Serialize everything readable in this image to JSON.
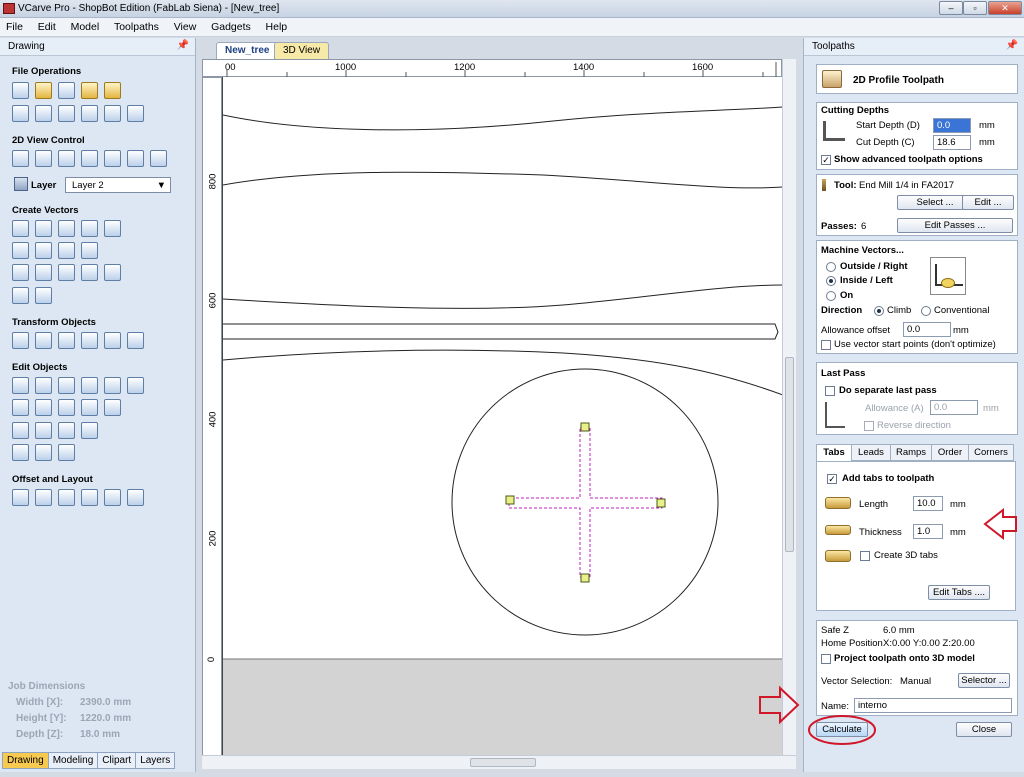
{
  "window": {
    "title": "VCarve Pro - ShopBot Edition (FabLab Siena) - [New_tree]",
    "min": "–",
    "max": "▫",
    "close": "✕"
  },
  "menu": [
    "File",
    "Edit",
    "Model",
    "Toolpaths",
    "View",
    "Gadgets",
    "Help"
  ],
  "left_panel": {
    "title": "Drawing",
    "sections": {
      "file_operations": "File Operations",
      "view_control": "2D View Control",
      "layer_label": "Layer",
      "layer_value": "Layer 2",
      "create_vectors": "Create Vectors",
      "transform_objects": "Transform Objects",
      "edit_objects": "Edit Objects",
      "offset_layout": "Offset and Layout"
    },
    "job": {
      "heading": "Job Dimensions",
      "width_label": "Width  [X]:",
      "width_value": "2390.0 mm",
      "height_label": "Height [Y]:",
      "height_value": "1220.0 mm",
      "depth_label": "Depth  [Z]:",
      "depth_value": "18.0 mm"
    },
    "bottom_tabs": [
      "Drawing",
      "Modeling",
      "Clipart",
      "Layers"
    ]
  },
  "document_tabs": [
    "New_tree",
    "3D View"
  ],
  "ruler": {
    "top": [
      "00",
      "1000",
      "1200",
      "1400",
      "1600"
    ],
    "left": [
      "800",
      "600",
      "400",
      "200",
      "0"
    ]
  },
  "right_panel": {
    "title": "Toolpaths",
    "header": "2D Profile Toolpath",
    "cutting": {
      "heading": "Cutting Depths",
      "start_label": "Start Depth (D)",
      "start_value": "0.0",
      "start_unit": "mm",
      "cut_label": "Cut Depth (C)",
      "cut_value": "18.6",
      "cut_unit": "mm",
      "advanced": "Show advanced toolpath options"
    },
    "tool": {
      "label": "Tool:",
      "value": "End Mill 1/4 in FA2017",
      "select": "Select ...",
      "edit": "Edit ...",
      "passes_label": "Passes:",
      "passes_value": "6",
      "edit_passes": "Edit Passes ..."
    },
    "machine": {
      "heading": "Machine Vectors...",
      "outside": "Outside / Right",
      "inside": "Inside / Left",
      "on": "On",
      "direction": "Direction",
      "climb": "Climb",
      "conventional": "Conventional",
      "allowance_label": "Allowance offset",
      "allowance_value": "0.0",
      "allowance_unit": "mm",
      "vector_start": "Use vector start points (don't optimize)"
    },
    "last_pass": {
      "heading": "Last Pass",
      "separate": "Do separate last pass",
      "allowance_label": "Allowance (A)",
      "allowance_value": "0.0",
      "allowance_unit": "mm",
      "reverse": "Reverse direction"
    },
    "tabs_section": {
      "tabs": [
        "Tabs",
        "Leads",
        "Ramps",
        "Order",
        "Corners"
      ],
      "add_tabs": "Add tabs to toolpath",
      "length_label": "Length",
      "length_value": "10.0",
      "length_unit": "mm",
      "thickness_label": "Thickness",
      "thickness_value": "1.0",
      "thickness_unit": "mm",
      "create3d": "Create 3D tabs",
      "edit_tabs": "Edit Tabs ...."
    },
    "info": {
      "safez_label": "Safe Z",
      "safez_value": "6.0 mm",
      "home_label": "Home Position",
      "home_value": "X:0.00 Y:0.00 Z:20.00",
      "project": "Project toolpath onto 3D model",
      "vector_sel_label": "Vector Selection:",
      "vector_sel_value": "Manual",
      "selector": "Selector ...",
      "name_label": "Name:",
      "name_value": "interno"
    },
    "calculate": "Calculate",
    "close": "Close"
  },
  "colors": {
    "annotation": "#d0182a",
    "tab_active": "#f7c94f",
    "selection": "#c020c0"
  }
}
